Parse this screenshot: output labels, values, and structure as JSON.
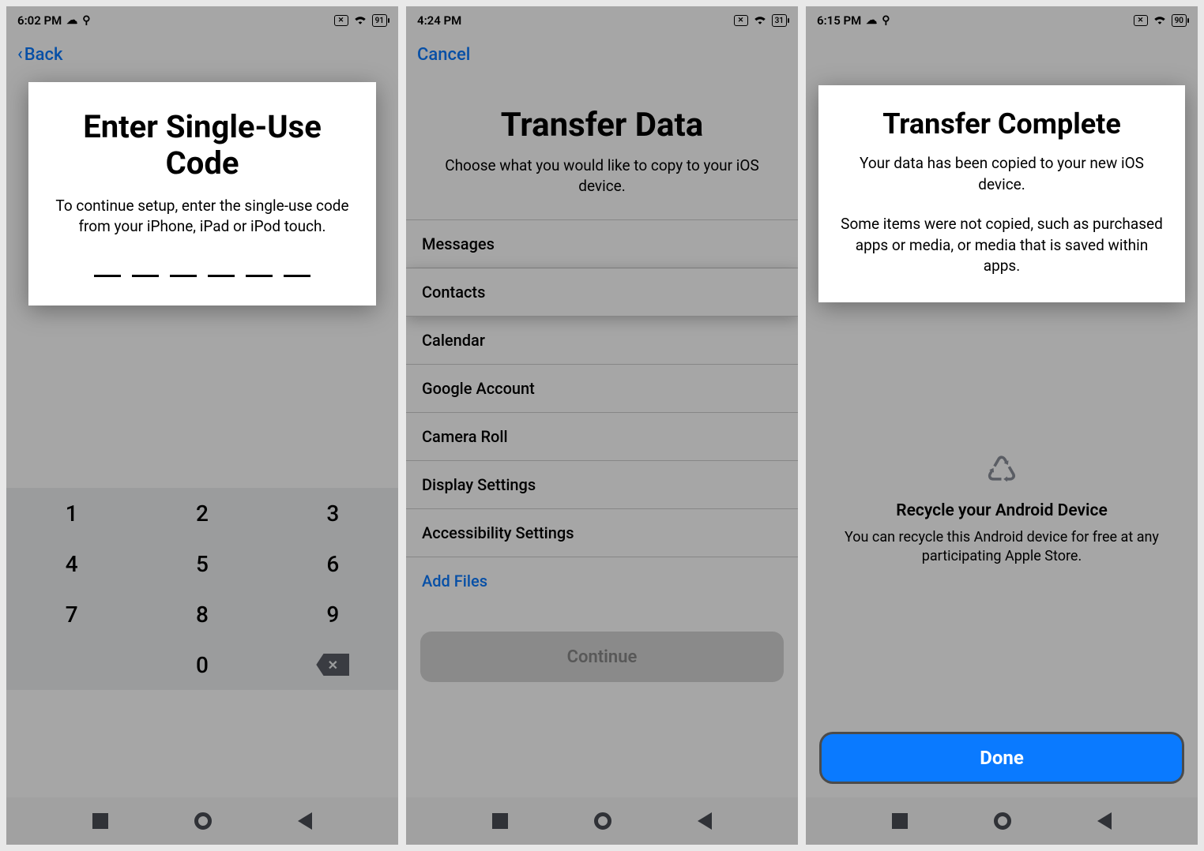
{
  "screens": [
    {
      "status": {
        "time": "6:02 PM",
        "weather": "cloud",
        "loc": "o",
        "xbox": "x",
        "wifi": true,
        "battery": "91"
      },
      "back_label": "Back",
      "title": "Enter Single-Use Code",
      "subtitle": "To continue setup, enter the single-use code from your iPhone, iPad or iPod touch.",
      "code_length": 6,
      "keypad": [
        "1",
        "2",
        "3",
        "4",
        "5",
        "6",
        "7",
        "8",
        "9",
        "",
        "0",
        "⌫"
      ]
    },
    {
      "status": {
        "time": "4:24 PM",
        "weather": "",
        "loc": "",
        "xbox": "x",
        "wifi": true,
        "battery": "31"
      },
      "cancel_label": "Cancel",
      "title": "Transfer Data",
      "subtitle": "Choose what you would like to copy to your iOS device.",
      "items": [
        {
          "label": "Messages",
          "highlight": false
        },
        {
          "label": "Contacts",
          "highlight": true
        },
        {
          "label": "Calendar",
          "highlight": false
        },
        {
          "label": "Google Account",
          "highlight": false
        },
        {
          "label": "Camera Roll",
          "highlight": false
        },
        {
          "label": "Display Settings",
          "highlight": false
        },
        {
          "label": "Accessibility Settings",
          "highlight": false
        }
      ],
      "add_files_label": "Add Files",
      "continue_label": "Continue"
    },
    {
      "status": {
        "time": "6:15 PM",
        "weather": "cloud",
        "loc": "o",
        "xbox": "x",
        "wifi": true,
        "battery": "90"
      },
      "title": "Transfer Complete",
      "para1": "Your data has been copied to your new iOS device.",
      "para2": "Some items were not copied, such as purchased apps or media, or media that is saved within apps.",
      "recycle_title": "Recycle your Android Device",
      "recycle_body": "You can recycle this Android device for free at any participating Apple Store.",
      "done_label": "Done"
    }
  ]
}
